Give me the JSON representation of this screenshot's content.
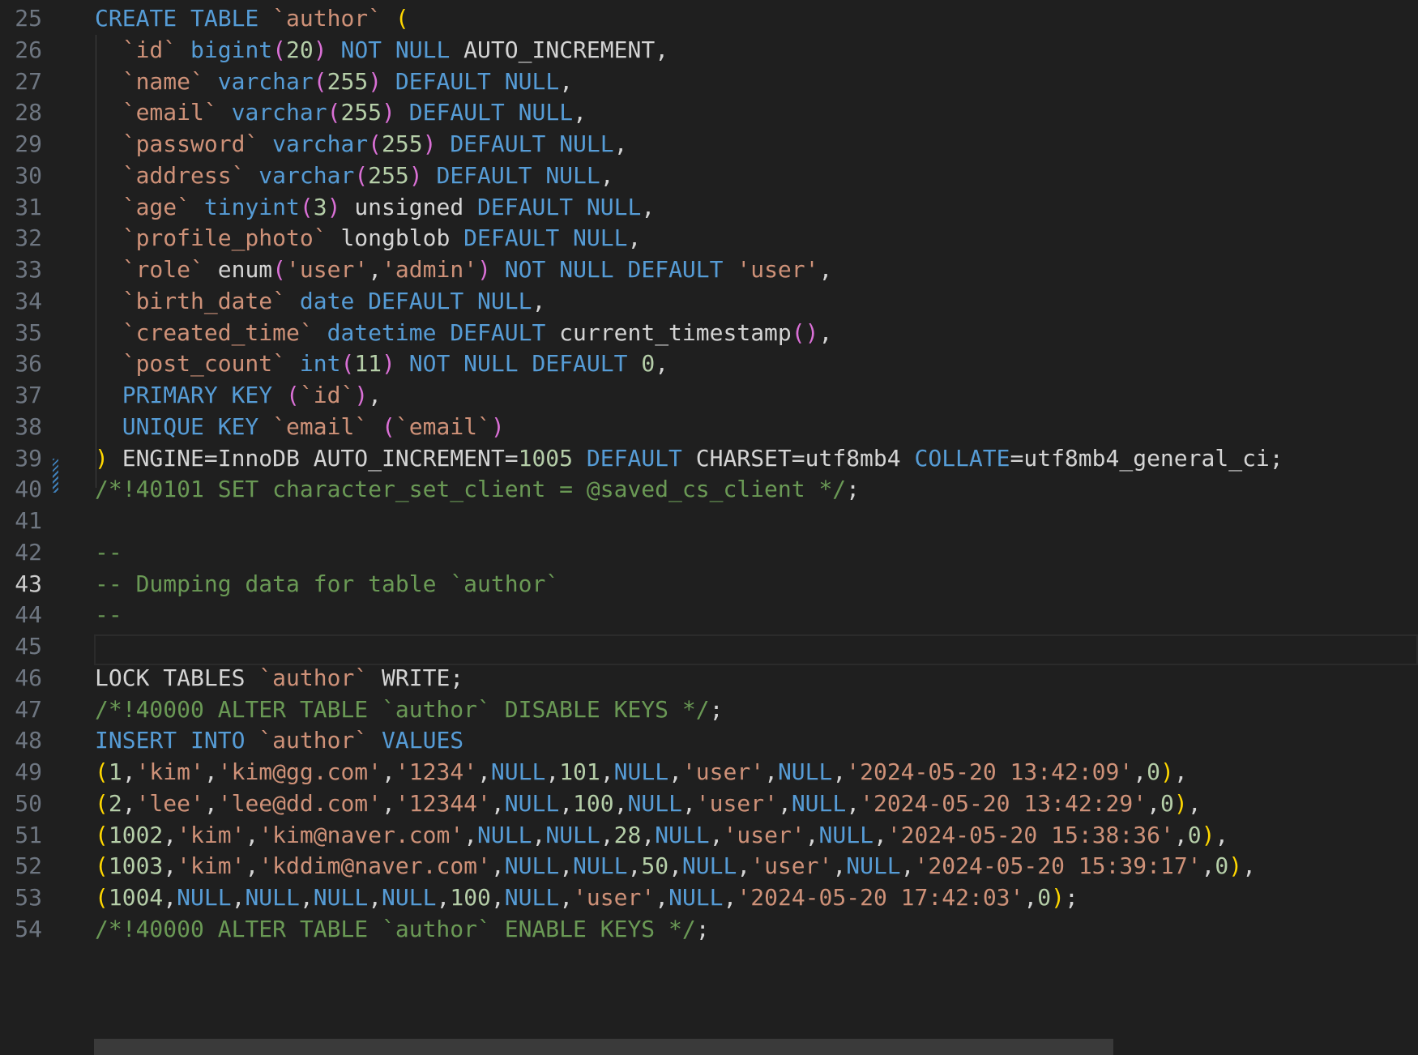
{
  "editor": {
    "language": "SQL",
    "first_line_number": 25,
    "active_line": 43,
    "lines": [
      {
        "n": 25,
        "tokens": [
          [
            "kw",
            "CREATE TABLE"
          ],
          [
            "pl",
            " "
          ],
          [
            "id",
            "`author`"
          ],
          [
            "pl",
            " "
          ],
          [
            "p1",
            "("
          ]
        ]
      },
      {
        "n": 26,
        "tokens": [
          [
            "pl",
            "  "
          ],
          [
            "id",
            "`id`"
          ],
          [
            "pl",
            " "
          ],
          [
            "ty",
            "bigint"
          ],
          [
            "p2",
            "("
          ],
          [
            "num",
            "20"
          ],
          [
            "p2",
            ")"
          ],
          [
            "pl",
            " "
          ],
          [
            "kw",
            "NOT NULL"
          ],
          [
            "pl",
            " AUTO_INCREMENT,"
          ]
        ]
      },
      {
        "n": 27,
        "tokens": [
          [
            "pl",
            "  "
          ],
          [
            "id",
            "`name`"
          ],
          [
            "pl",
            " "
          ],
          [
            "ty",
            "varchar"
          ],
          [
            "p2",
            "("
          ],
          [
            "num",
            "255"
          ],
          [
            "p2",
            ")"
          ],
          [
            "pl",
            " "
          ],
          [
            "kw",
            "DEFAULT NULL"
          ],
          [
            "pl",
            ","
          ]
        ]
      },
      {
        "n": 28,
        "tokens": [
          [
            "pl",
            "  "
          ],
          [
            "id",
            "`email`"
          ],
          [
            "pl",
            " "
          ],
          [
            "ty",
            "varchar"
          ],
          [
            "p2",
            "("
          ],
          [
            "num",
            "255"
          ],
          [
            "p2",
            ")"
          ],
          [
            "pl",
            " "
          ],
          [
            "kw",
            "DEFAULT NULL"
          ],
          [
            "pl",
            ","
          ]
        ]
      },
      {
        "n": 29,
        "tokens": [
          [
            "pl",
            "  "
          ],
          [
            "id",
            "`password`"
          ],
          [
            "pl",
            " "
          ],
          [
            "ty",
            "varchar"
          ],
          [
            "p2",
            "("
          ],
          [
            "num",
            "255"
          ],
          [
            "p2",
            ")"
          ],
          [
            "pl",
            " "
          ],
          [
            "kw",
            "DEFAULT NULL"
          ],
          [
            "pl",
            ","
          ]
        ]
      },
      {
        "n": 30,
        "tokens": [
          [
            "pl",
            "  "
          ],
          [
            "id",
            "`address`"
          ],
          [
            "pl",
            " "
          ],
          [
            "ty",
            "varchar"
          ],
          [
            "p2",
            "("
          ],
          [
            "num",
            "255"
          ],
          [
            "p2",
            ")"
          ],
          [
            "pl",
            " "
          ],
          [
            "kw",
            "DEFAULT NULL"
          ],
          [
            "pl",
            ","
          ]
        ]
      },
      {
        "n": 31,
        "tokens": [
          [
            "pl",
            "  "
          ],
          [
            "id",
            "`age`"
          ],
          [
            "pl",
            " "
          ],
          [
            "ty",
            "tinyint"
          ],
          [
            "p2",
            "("
          ],
          [
            "num",
            "3"
          ],
          [
            "p2",
            ")"
          ],
          [
            "pl",
            " unsigned "
          ],
          [
            "kw",
            "DEFAULT NULL"
          ],
          [
            "pl",
            ","
          ]
        ]
      },
      {
        "n": 32,
        "tokens": [
          [
            "pl",
            "  "
          ],
          [
            "id",
            "`profile_photo`"
          ],
          [
            "pl",
            " longblob "
          ],
          [
            "kw",
            "DEFAULT NULL"
          ],
          [
            "pl",
            ","
          ]
        ]
      },
      {
        "n": 33,
        "tokens": [
          [
            "pl",
            "  "
          ],
          [
            "id",
            "`role`"
          ],
          [
            "pl",
            " enum"
          ],
          [
            "p2",
            "("
          ],
          [
            "str",
            "'user'"
          ],
          [
            "pl",
            ","
          ],
          [
            "str",
            "'admin'"
          ],
          [
            "p2",
            ")"
          ],
          [
            "pl",
            " "
          ],
          [
            "kw",
            "NOT NULL DEFAULT"
          ],
          [
            "pl",
            " "
          ],
          [
            "str",
            "'user'"
          ],
          [
            "pl",
            ","
          ]
        ]
      },
      {
        "n": 34,
        "tokens": [
          [
            "pl",
            "  "
          ],
          [
            "id",
            "`birth_date`"
          ],
          [
            "pl",
            " "
          ],
          [
            "ty",
            "date"
          ],
          [
            "pl",
            " "
          ],
          [
            "kw",
            "DEFAULT NULL"
          ],
          [
            "pl",
            ","
          ]
        ]
      },
      {
        "n": 35,
        "tokens": [
          [
            "pl",
            "  "
          ],
          [
            "id",
            "`created_time`"
          ],
          [
            "pl",
            " "
          ],
          [
            "ty",
            "datetime"
          ],
          [
            "pl",
            " "
          ],
          [
            "kw",
            "DEFAULT"
          ],
          [
            "pl",
            " current_timestamp"
          ],
          [
            "p2",
            "()"
          ],
          [
            "pl",
            ","
          ]
        ]
      },
      {
        "n": 36,
        "tokens": [
          [
            "pl",
            "  "
          ],
          [
            "id",
            "`post_count`"
          ],
          [
            "pl",
            " "
          ],
          [
            "ty",
            "int"
          ],
          [
            "p2",
            "("
          ],
          [
            "num",
            "11"
          ],
          [
            "p2",
            ")"
          ],
          [
            "pl",
            " "
          ],
          [
            "kw",
            "NOT NULL DEFAULT"
          ],
          [
            "pl",
            " "
          ],
          [
            "num",
            "0"
          ],
          [
            "pl",
            ","
          ]
        ]
      },
      {
        "n": 37,
        "tokens": [
          [
            "pl",
            "  "
          ],
          [
            "kw",
            "PRIMARY KEY"
          ],
          [
            "pl",
            " "
          ],
          [
            "p2",
            "("
          ],
          [
            "id",
            "`id`"
          ],
          [
            "p2",
            ")"
          ],
          [
            "pl",
            ","
          ]
        ]
      },
      {
        "n": 38,
        "tokens": [
          [
            "pl",
            "  "
          ],
          [
            "kw",
            "UNIQUE KEY"
          ],
          [
            "pl",
            " "
          ],
          [
            "id",
            "`email`"
          ],
          [
            "pl",
            " "
          ],
          [
            "p2",
            "("
          ],
          [
            "id",
            "`email`"
          ],
          [
            "p2",
            ")"
          ]
        ]
      },
      {
        "n": 39,
        "tokens": [
          [
            "p1",
            ")"
          ],
          [
            "pl",
            " ENGINE=InnoDB AUTO_INCREMENT="
          ],
          [
            "num",
            "1005"
          ],
          [
            "pl",
            " "
          ],
          [
            "kw",
            "DEFAULT"
          ],
          [
            "pl",
            " CHARSET=utf8mb4 "
          ],
          [
            "kw",
            "COLLATE"
          ],
          [
            "pl",
            "=utf8mb4_general_ci;"
          ]
        ]
      },
      {
        "n": 40,
        "tokens": [
          [
            "cm",
            "/*!40101 SET character_set_client = @saved_cs_client */"
          ],
          [
            "pl",
            ";"
          ]
        ]
      },
      {
        "n": 41,
        "tokens": []
      },
      {
        "n": 42,
        "tokens": [
          [
            "cm",
            "--"
          ]
        ]
      },
      {
        "n": 43,
        "tokens": [
          [
            "cm",
            "-- Dumping data for table `author`"
          ]
        ]
      },
      {
        "n": 44,
        "tokens": [
          [
            "cm",
            "--"
          ]
        ]
      },
      {
        "n": 45,
        "tokens": []
      },
      {
        "n": 46,
        "tokens": [
          [
            "pl",
            "LOCK TABLES "
          ],
          [
            "id",
            "`author`"
          ],
          [
            "pl",
            " WRITE;"
          ]
        ]
      },
      {
        "n": 47,
        "tokens": [
          [
            "cm",
            "/*!40000 ALTER TABLE `author` DISABLE KEYS */"
          ],
          [
            "pl",
            ";"
          ]
        ]
      },
      {
        "n": 48,
        "tokens": [
          [
            "kw",
            "INSERT INTO"
          ],
          [
            "pl",
            " "
          ],
          [
            "id",
            "`author`"
          ],
          [
            "pl",
            " "
          ],
          [
            "kw",
            "VALUES"
          ]
        ]
      },
      {
        "n": 49,
        "tokens": [
          [
            "p1",
            "("
          ],
          [
            "num",
            "1"
          ],
          [
            "pl",
            ","
          ],
          [
            "str",
            "'kim'"
          ],
          [
            "pl",
            ","
          ],
          [
            "str",
            "'kim@gg.com'"
          ],
          [
            "pl",
            ","
          ],
          [
            "str",
            "'1234'"
          ],
          [
            "pl",
            ","
          ],
          [
            "kw",
            "NULL"
          ],
          [
            "pl",
            ","
          ],
          [
            "num",
            "101"
          ],
          [
            "pl",
            ","
          ],
          [
            "kw",
            "NULL"
          ],
          [
            "pl",
            ","
          ],
          [
            "str",
            "'user'"
          ],
          [
            "pl",
            ","
          ],
          [
            "kw",
            "NULL"
          ],
          [
            "pl",
            ","
          ],
          [
            "str",
            "'2024-05-20 13:42:09'"
          ],
          [
            "pl",
            ","
          ],
          [
            "num",
            "0"
          ],
          [
            "p1",
            ")"
          ],
          [
            "pl",
            ","
          ]
        ]
      },
      {
        "n": 50,
        "tokens": [
          [
            "p1",
            "("
          ],
          [
            "num",
            "2"
          ],
          [
            "pl",
            ","
          ],
          [
            "str",
            "'lee'"
          ],
          [
            "pl",
            ","
          ],
          [
            "str",
            "'lee@dd.com'"
          ],
          [
            "pl",
            ","
          ],
          [
            "str",
            "'12344'"
          ],
          [
            "pl",
            ","
          ],
          [
            "kw",
            "NULL"
          ],
          [
            "pl",
            ","
          ],
          [
            "num",
            "100"
          ],
          [
            "pl",
            ","
          ],
          [
            "kw",
            "NULL"
          ],
          [
            "pl",
            ","
          ],
          [
            "str",
            "'user'"
          ],
          [
            "pl",
            ","
          ],
          [
            "kw",
            "NULL"
          ],
          [
            "pl",
            ","
          ],
          [
            "str",
            "'2024-05-20 13:42:29'"
          ],
          [
            "pl",
            ","
          ],
          [
            "num",
            "0"
          ],
          [
            "p1",
            ")"
          ],
          [
            "pl",
            ","
          ]
        ]
      },
      {
        "n": 51,
        "tokens": [
          [
            "p1",
            "("
          ],
          [
            "num",
            "1002"
          ],
          [
            "pl",
            ","
          ],
          [
            "str",
            "'kim'"
          ],
          [
            "pl",
            ","
          ],
          [
            "str",
            "'kim@naver.com'"
          ],
          [
            "pl",
            ","
          ],
          [
            "kw",
            "NULL"
          ],
          [
            "pl",
            ","
          ],
          [
            "kw",
            "NULL"
          ],
          [
            "pl",
            ","
          ],
          [
            "num",
            "28"
          ],
          [
            "pl",
            ","
          ],
          [
            "kw",
            "NULL"
          ],
          [
            "pl",
            ","
          ],
          [
            "str",
            "'user'"
          ],
          [
            "pl",
            ","
          ],
          [
            "kw",
            "NULL"
          ],
          [
            "pl",
            ","
          ],
          [
            "str",
            "'2024-05-20 15:38:36'"
          ],
          [
            "pl",
            ","
          ],
          [
            "num",
            "0"
          ],
          [
            "p1",
            ")"
          ],
          [
            "pl",
            ","
          ]
        ]
      },
      {
        "n": 52,
        "tokens": [
          [
            "p1",
            "("
          ],
          [
            "num",
            "1003"
          ],
          [
            "pl",
            ","
          ],
          [
            "str",
            "'kim'"
          ],
          [
            "pl",
            ","
          ],
          [
            "str",
            "'kddim@naver.com'"
          ],
          [
            "pl",
            ","
          ],
          [
            "kw",
            "NULL"
          ],
          [
            "pl",
            ","
          ],
          [
            "kw",
            "NULL"
          ],
          [
            "pl",
            ","
          ],
          [
            "num",
            "50"
          ],
          [
            "pl",
            ","
          ],
          [
            "kw",
            "NULL"
          ],
          [
            "pl",
            ","
          ],
          [
            "str",
            "'user'"
          ],
          [
            "pl",
            ","
          ],
          [
            "kw",
            "NULL"
          ],
          [
            "pl",
            ","
          ],
          [
            "str",
            "'2024-05-20 15:39:17'"
          ],
          [
            "pl",
            ","
          ],
          [
            "num",
            "0"
          ],
          [
            "p1",
            ")"
          ],
          [
            "pl",
            ","
          ]
        ]
      },
      {
        "n": 53,
        "tokens": [
          [
            "p1",
            "("
          ],
          [
            "num",
            "1004"
          ],
          [
            "pl",
            ","
          ],
          [
            "kw",
            "NULL"
          ],
          [
            "pl",
            ","
          ],
          [
            "kw",
            "NULL"
          ],
          [
            "pl",
            ","
          ],
          [
            "kw",
            "NULL"
          ],
          [
            "pl",
            ","
          ],
          [
            "kw",
            "NULL"
          ],
          [
            "pl",
            ","
          ],
          [
            "num",
            "100"
          ],
          [
            "pl",
            ","
          ],
          [
            "kw",
            "NULL"
          ],
          [
            "pl",
            ","
          ],
          [
            "str",
            "'user'"
          ],
          [
            "pl",
            ","
          ],
          [
            "kw",
            "NULL"
          ],
          [
            "pl",
            ","
          ],
          [
            "str",
            "'2024-05-20 17:42:03'"
          ],
          [
            "pl",
            ","
          ],
          [
            "num",
            "0"
          ],
          [
            "p1",
            ")"
          ],
          [
            "pl",
            ";"
          ]
        ]
      },
      {
        "n": 54,
        "tokens": [
          [
            "cm",
            "/*!40000 ALTER TABLE `author` ENABLE KEYS */"
          ],
          [
            "pl",
            ";"
          ]
        ]
      }
    ]
  }
}
